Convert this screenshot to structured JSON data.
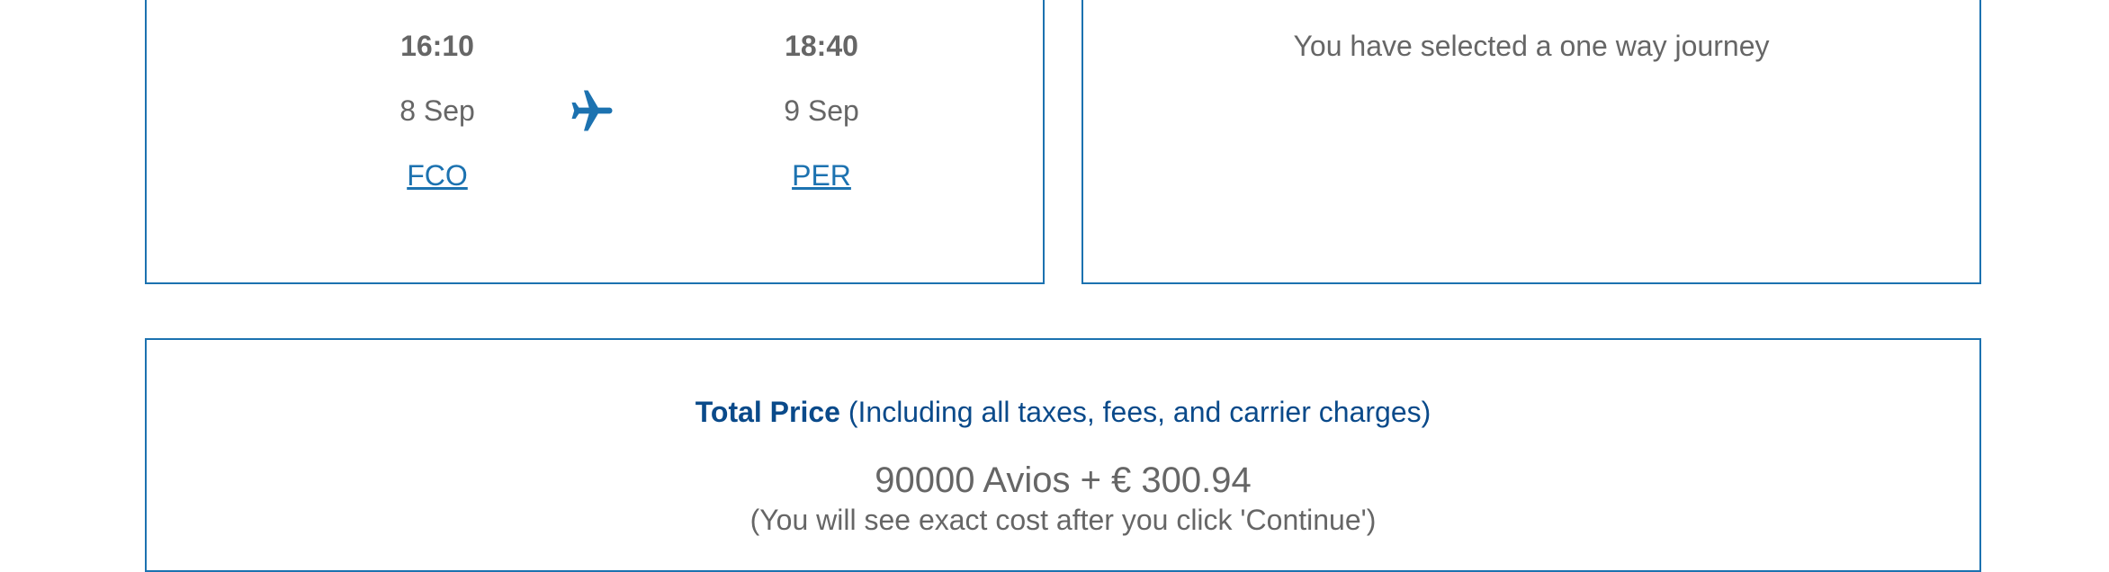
{
  "flight": {
    "departure": {
      "time": "16:10",
      "date": "8 Sep",
      "airport": "FCO"
    },
    "arrival": {
      "time": "18:40",
      "date": "9 Sep",
      "airport": "PER"
    },
    "icon": "plane-icon"
  },
  "journey": {
    "message": "You have selected a one way journey"
  },
  "price": {
    "heading_strong": "Total Price",
    "heading_note": "(Including all taxes, fees, and carrier charges)",
    "amount": "90000 Avios + € 300.94",
    "note": "(You will see exact cost after you click 'Continue')"
  },
  "colors": {
    "accent": "#1c72b0",
    "heading": "#0a4a8a",
    "text": "#666666"
  }
}
